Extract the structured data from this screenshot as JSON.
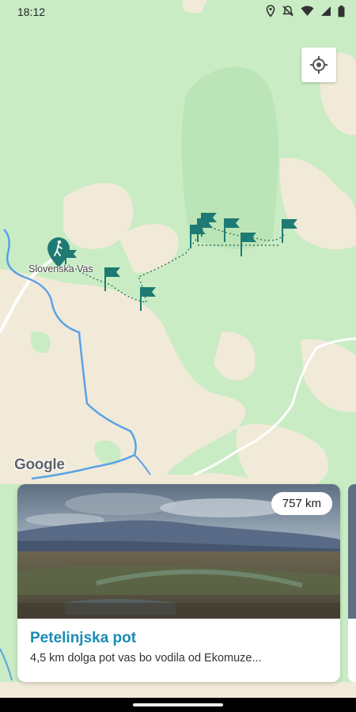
{
  "status_bar": {
    "time": "18:12"
  },
  "map": {
    "place_label": "Slovenska Vas",
    "attribution": "Google"
  },
  "trail_card": {
    "distance": "757 km",
    "title": "Petelinjska pot",
    "description": "4,5 km dolga pot vas bo vodila od Ekomuze..."
  },
  "colors": {
    "accent": "#1a8ab5",
    "marker": "#1e7a73",
    "map_green": "#c9ecc4",
    "map_sand": "#f2ead9"
  }
}
